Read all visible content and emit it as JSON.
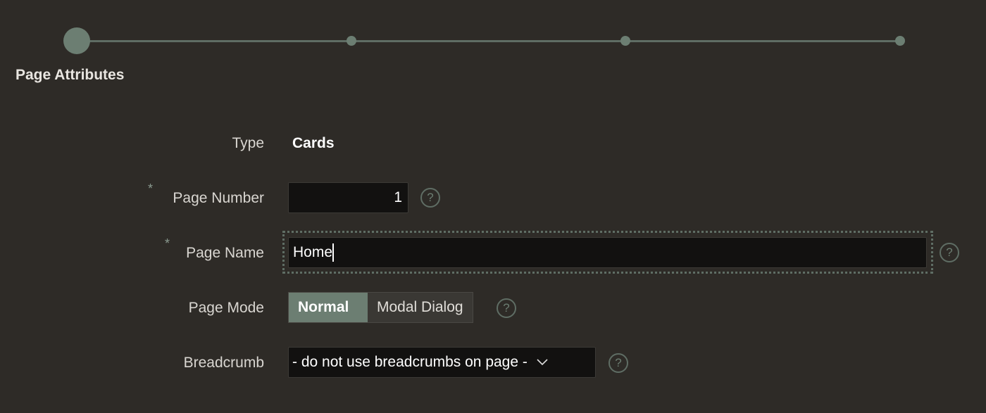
{
  "wizard": {
    "steps": [
      {
        "label": "Page Attributes",
        "active": true
      },
      {
        "active": false
      },
      {
        "active": false
      },
      {
        "active": false
      }
    ],
    "accent": "#6c7e72"
  },
  "form": {
    "type": {
      "label": "Type",
      "value": "Cards"
    },
    "page_number": {
      "label": "Page Number",
      "value": "1",
      "required": "*"
    },
    "page_name": {
      "label": "Page Name",
      "value": "Home",
      "required": "*"
    },
    "page_mode": {
      "label": "Page Mode",
      "options": [
        "Normal",
        "Modal Dialog"
      ],
      "selected": "Normal"
    },
    "breadcrumb": {
      "label": "Breadcrumb",
      "value": "- do not use breadcrumbs on page -"
    },
    "help_glyph": "?"
  }
}
